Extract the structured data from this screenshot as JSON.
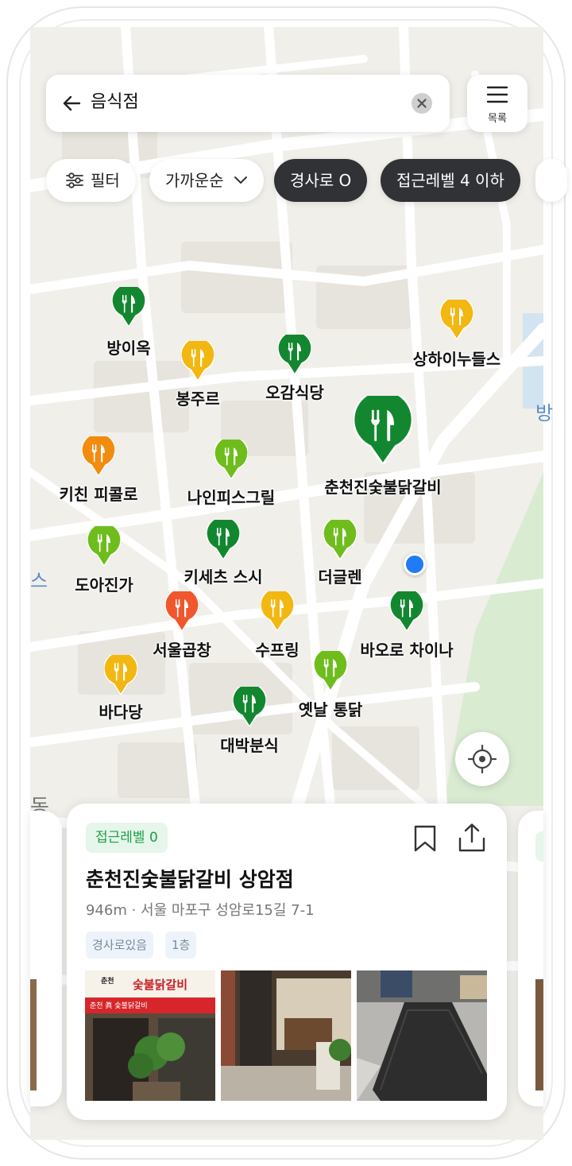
{
  "search": {
    "query": "음식점"
  },
  "list_button": {
    "label": "목록"
  },
  "chips": [
    {
      "label": "필터",
      "style": "light",
      "icon": "sliders-icon"
    },
    {
      "label": "가까운순",
      "style": "light",
      "icon": "chevron-down-icon"
    },
    {
      "label": "경사로 O",
      "style": "dark"
    },
    {
      "label": "접근레벨 4 이하",
      "style": "dark"
    }
  ],
  "colors": {
    "dark_green": "#13872f",
    "light_green": "#6ebd1c",
    "yellow": "#f2b711",
    "orange": "#f28c0e",
    "red": "#f1562c",
    "blue_dot": "#1f7cf5"
  },
  "map_labels": {
    "left_edge": "스",
    "left_bottom": "동",
    "right_edge": "방"
  },
  "places": [
    {
      "name": "방이옥",
      "color": "dark_green"
    },
    {
      "name": "봉주르",
      "color": "yellow"
    },
    {
      "name": "오감식당",
      "color": "dark_green"
    },
    {
      "name": "상하이누들스",
      "color": "yellow"
    },
    {
      "name": "춘천진숯불닭갈비",
      "color": "dark_green",
      "selected": true
    },
    {
      "name": "키친 피콜로",
      "color": "orange"
    },
    {
      "name": "나인피스그릴",
      "color": "light_green"
    },
    {
      "name": "도아진가",
      "color": "light_green"
    },
    {
      "name": "키세츠 스시",
      "color": "dark_green"
    },
    {
      "name": "더글렌",
      "color": "light_green"
    },
    {
      "name": "서울곱창",
      "color": "red"
    },
    {
      "name": "수프링",
      "color": "yellow"
    },
    {
      "name": "바오로 차이나",
      "color": "dark_green"
    },
    {
      "name": "바다당",
      "color": "yellow"
    },
    {
      "name": "옛날 통닭",
      "color": "light_green"
    },
    {
      "name": "대박분식",
      "color": "dark_green"
    }
  ],
  "card": {
    "badge": "접근레벨 0",
    "title": "춘천진숯불닭갈비 상암점",
    "address": "946m · 서울 마포구 성암로15길 7-1",
    "tags": [
      "경사로있음",
      "1층"
    ],
    "photo_sign_text": "숯불닭갈비",
    "photo_sign_prefix": "춘천",
    "photo_sign_sub": "춘천 眞 숯불닭갈비"
  }
}
